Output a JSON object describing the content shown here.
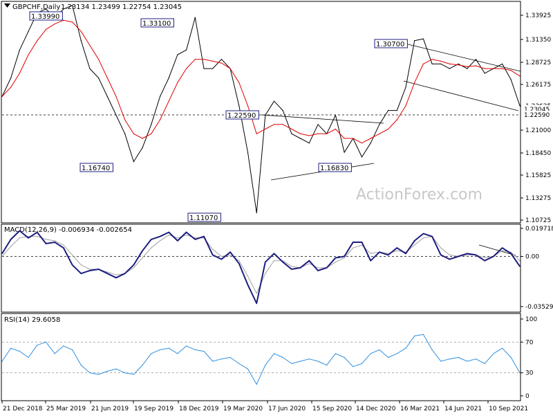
{
  "chart_data": [
    {
      "type": "line",
      "header": "GBPCHF,Daily",
      "ohlc_text": "1.23134 1.23499 1.22754 1.23045",
      "watermark": "ActionForex.com",
      "y_ticks": [
        "1.33925",
        "1.31350",
        "1.28725",
        "1.26175",
        "1.23625",
        "1.21000",
        "1.18450",
        "1.15825",
        "1.13275",
        "1.10725"
      ],
      "ylim": [
        1.10725,
        1.33925
      ],
      "current_price": "1.23045",
      "last_level": "1.22590",
      "colors": {
        "price": "#000000",
        "ma": "#e00000",
        "trendline": "#000000",
        "level": "#000000"
      },
      "annotations": [
        "1.33990",
        "1.33100",
        "1.16740",
        "1.11070",
        "1.22590",
        "1.16830",
        "1.30700"
      ],
      "x_ticks": [
        "21 Dec 2018",
        "25 Mar 2019",
        "21 Jun 2019",
        "19 Sep 2019",
        "18 Dec 2019",
        "19 Mar 2020",
        "17 Jun 2020",
        "15 Sep 2020",
        "14 Dec 2020",
        "16 Mar 2021",
        "14 Jun 2021",
        "10 Sep 2021"
      ],
      "series": [
        {
          "name": "",
          "role": "price",
          "values": [
            1.24,
            1.26,
            1.29,
            1.31,
            1.33,
            1.334,
            1.325,
            1.334,
            1.338,
            1.3,
            1.27,
            1.26,
            1.24,
            1.22,
            1.2,
            1.17,
            1.185,
            1.21,
            1.24,
            1.26,
            1.285,
            1.29,
            1.325,
            1.27,
            1.27,
            1.28,
            1.27,
            1.23,
            1.18,
            1.115,
            1.22,
            1.235,
            1.225,
            1.2,
            1.195,
            1.19,
            1.21,
            1.2,
            1.22,
            1.18,
            1.195,
            1.175,
            1.19,
            1.21,
            1.225,
            1.225,
            1.25,
            1.3,
            1.302,
            1.275,
            1.275,
            1.27,
            1.275,
            1.27,
            1.28,
            1.265,
            1.27,
            1.275,
            1.258,
            1.23
          ]
        },
        {
          "name": "",
          "role": "moving-average",
          "values": [
            1.24,
            1.25,
            1.265,
            1.285,
            1.3,
            1.312,
            1.318,
            1.322,
            1.32,
            1.31,
            1.295,
            1.28,
            1.26,
            1.24,
            1.215,
            1.2,
            1.195,
            1.2,
            1.215,
            1.235,
            1.255,
            1.27,
            1.28,
            1.28,
            1.278,
            1.276,
            1.27,
            1.255,
            1.23,
            1.2,
            1.205,
            1.21,
            1.21,
            1.205,
            1.2,
            1.198,
            1.2,
            1.2,
            1.205,
            1.195,
            1.195,
            1.19,
            1.195,
            1.2,
            1.205,
            1.215,
            1.23,
            1.255,
            1.275,
            1.28,
            1.278,
            1.275,
            1.274,
            1.272,
            1.273,
            1.27,
            1.27,
            1.27,
            1.268,
            1.262
          ]
        }
      ]
    },
    {
      "type": "line",
      "header": "MACD(12,26,9) -0.006934 -0.002654",
      "y_ticks": [
        "0.019718",
        "0.00",
        "-0.035295"
      ],
      "ylim": [
        -0.035295,
        0.019718
      ],
      "colors": {
        "macd": "#1c1c7e",
        "signal": "#a0a0a0"
      },
      "series": [
        {
          "name": "",
          "role": "macd",
          "values": [
            0.002,
            0.012,
            0.018,
            0.013,
            0.017,
            0.009,
            0.01,
            0.006,
            -0.006,
            -0.012,
            -0.01,
            -0.009,
            -0.012,
            -0.015,
            -0.012,
            -0.006,
            0.004,
            0.012,
            0.014,
            0.017,
            0.011,
            0.017,
            0.012,
            0.014,
            0.001,
            -0.002,
            0.003,
            -0.005,
            -0.02,
            -0.033,
            -0.004,
            0.002,
            -0.004,
            -0.009,
            -0.008,
            -0.003,
            -0.01,
            -0.008,
            -0.001,
            0.0,
            0.01,
            0.01,
            -0.003,
            0.003,
            0.001,
            0.006,
            0.002,
            0.011,
            0.016,
            0.014,
            0.001,
            -0.002,
            0.0,
            0.002,
            0.001,
            -0.003,
            0.0,
            0.006,
            0.002,
            -0.007
          ]
        },
        {
          "name": "",
          "role": "signal",
          "values": [
            0.0,
            0.007,
            0.013,
            0.014,
            0.014,
            0.012,
            0.011,
            0.008,
            0.001,
            -0.006,
            -0.009,
            -0.009,
            -0.011,
            -0.013,
            -0.012,
            -0.008,
            -0.001,
            0.006,
            0.011,
            0.015,
            0.013,
            0.015,
            0.013,
            0.013,
            0.005,
            0.0,
            0.001,
            -0.003,
            -0.014,
            -0.026,
            -0.012,
            -0.003,
            -0.003,
            -0.007,
            -0.008,
            -0.005,
            -0.008,
            -0.008,
            -0.004,
            -0.001,
            0.006,
            0.008,
            0.002,
            0.003,
            0.002,
            0.004,
            0.003,
            0.008,
            0.013,
            0.014,
            0.006,
            0.001,
            0.0,
            0.001,
            0.001,
            -0.001,
            0.0,
            0.004,
            0.003,
            -0.003
          ]
        }
      ]
    },
    {
      "type": "line",
      "header": "RSI(14) 29.6058",
      "y_ticks": [
        "100",
        "70",
        "30",
        "0"
      ],
      "ylim": [
        0,
        100
      ],
      "colors": {
        "rsi": "#2f8fde",
        "level": "#a0a0a0"
      },
      "series": [
        {
          "name": "",
          "role": "rsi",
          "values": [
            45,
            62,
            58,
            50,
            66,
            70,
            55,
            65,
            60,
            40,
            30,
            28,
            32,
            35,
            30,
            28,
            40,
            55,
            60,
            62,
            55,
            65,
            60,
            58,
            45,
            48,
            50,
            42,
            35,
            15,
            40,
            55,
            50,
            42,
            45,
            48,
            45,
            40,
            55,
            50,
            38,
            42,
            55,
            60,
            50,
            55,
            62,
            78,
            80,
            60,
            45,
            48,
            50,
            45,
            48,
            42,
            55,
            62,
            50,
            30
          ]
        }
      ]
    }
  ]
}
